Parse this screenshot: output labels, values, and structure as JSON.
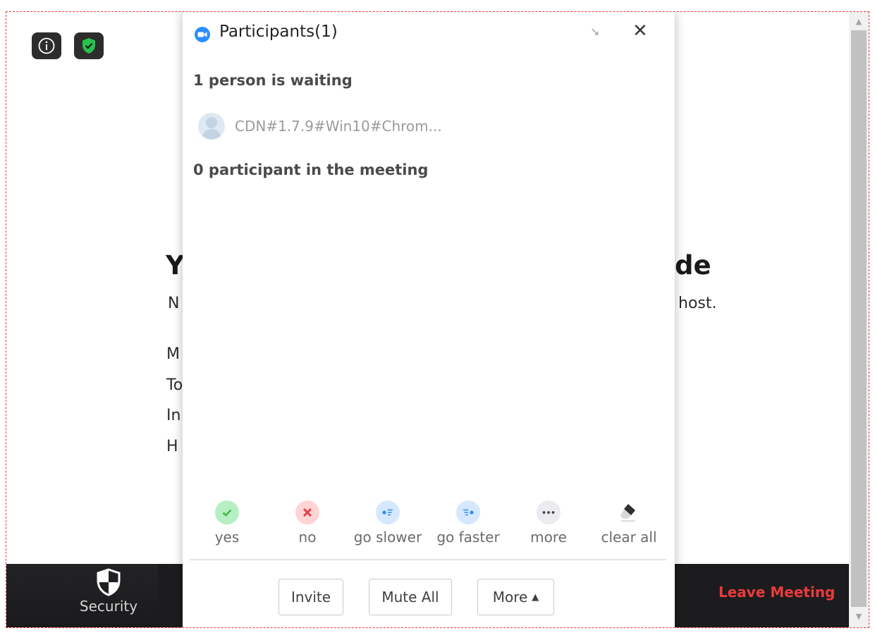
{
  "top_icons": {
    "info": "info-icon",
    "security": "shield-check-icon"
  },
  "background": {
    "heading_left": "Y",
    "heading_right": "de",
    "line1_left": "N",
    "line1_right": "host.",
    "rows": [
      "M",
      "To",
      "In",
      "H"
    ]
  },
  "panel": {
    "title": "Participants(1)",
    "waiting_title": "1 person is waiting",
    "waiting_name": "CDN#1.7.9#Win10#Chrom...",
    "in_meeting_title": "0 participant in the meeting"
  },
  "reactions": [
    {
      "label": "yes",
      "icon": "check-icon",
      "color": "#3fb950"
    },
    {
      "label": "no",
      "icon": "x-icon",
      "color": "#e5393c"
    },
    {
      "label": "go slower",
      "icon": "go-slower-icon",
      "color": "#2d8cff"
    },
    {
      "label": "go faster",
      "icon": "go-faster-icon",
      "color": "#2d8cff"
    },
    {
      "label": "more",
      "icon": "more-dots-icon",
      "color": "#555555"
    },
    {
      "label": "clear all",
      "icon": "eraser-icon",
      "color": "#333333"
    }
  ],
  "footer": {
    "invite": "Invite",
    "mute_all": "Mute All",
    "more": "More"
  },
  "toolbar": {
    "security": "Security",
    "leave": "Leave Meeting"
  },
  "colors": {
    "accent": "#2d8cff",
    "leave": "#ea3b3b",
    "toolbar_bg": "#1c1c1e"
  }
}
